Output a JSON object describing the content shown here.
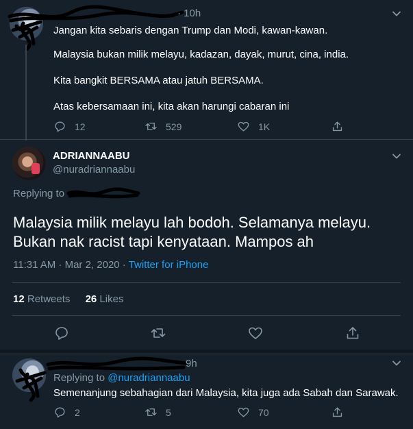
{
  "tweet1": {
    "time": "· 10h",
    "lines": [
      "Jangan kita sebaris dengan Trump dan Modi, kawan-kawan.",
      "Malaysia bukan milik melayu, kadazan, dayak, murut, cina, india.",
      "Kita bangkit BERSAMA atau jatuh BERSAMA.",
      "Atas kebersamaan ini, kita akan harungi cabaran ini"
    ],
    "reply_count": "12",
    "retweet_count": "529",
    "like_count": "1K"
  },
  "main_tweet": {
    "display_name": "ADRIANNAABU",
    "handle": "@nuradriannaabu",
    "replying_to_label": "Replying to",
    "text_line1": "Malaysia milik melayu lah bodoh. Selamanya melayu.",
    "text_line2": "Bukan nak racist tapi kenyataan. Mampos ah",
    "timestamp": "11:31 AM · Mar 2, 2020 ·",
    "source": "Twitter for iPhone",
    "retweets_count": "12",
    "retweets_label": "Retweets",
    "likes_count": "26",
    "likes_label": "Likes"
  },
  "tweet3": {
    "time": "9h",
    "replying_to_label": "Replying to",
    "replying_to_handle": "@nuradriannaabu",
    "text": "Semenanjung sebahagian dari Malaysia, kita juga ada Sabah dan Sarawak.",
    "reply_count": "2",
    "retweet_count": "5",
    "like_count": "70"
  },
  "colors": {
    "background": "#15202b",
    "muted": "#8899a6",
    "accent": "#1da1f2",
    "divider": "#38444d"
  },
  "icons": [
    "chevron-down-icon",
    "reply-icon",
    "retweet-icon",
    "like-icon",
    "share-icon"
  ]
}
